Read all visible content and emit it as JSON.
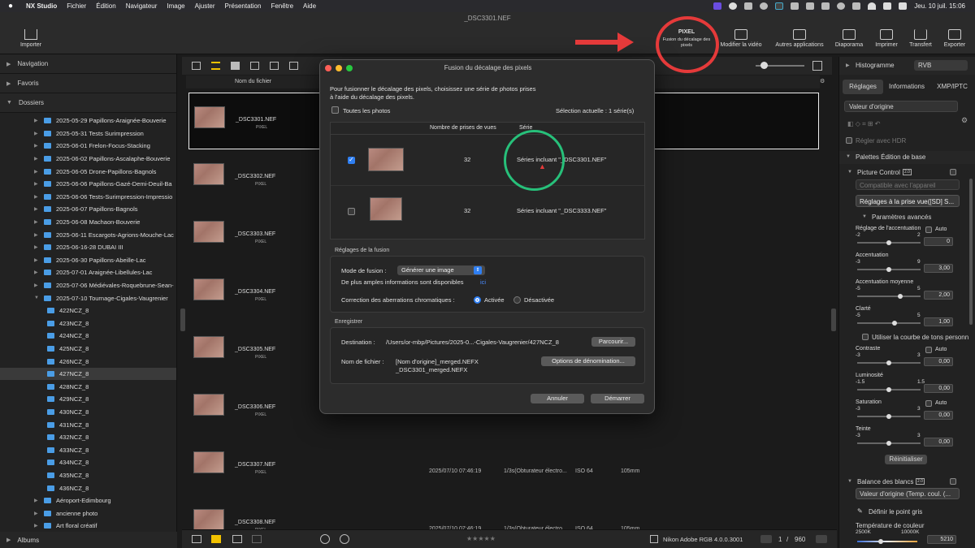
{
  "menubar": {
    "app": "NX Studio",
    "items": [
      "Fichier",
      "Édition",
      "Navigateur",
      "Image",
      "Ajuster",
      "Présentation",
      "Fenêtre",
      "Aide"
    ],
    "clock": "Jeu. 10 juil.  15:06"
  },
  "window": {
    "title": "_DSC3301.NEF"
  },
  "toolbar": {
    "import": "Importer",
    "pixel_shift": "Fusion du décalage des pixels",
    "pixel_badge": "PIXEL",
    "edit_video": "Modifier la vidéo",
    "other_apps": "Autres applications",
    "slideshow": "Diaporama",
    "print": "Imprimer",
    "transfer": "Transfert",
    "export": "Exporter"
  },
  "left": {
    "navigation": "Navigation",
    "favorites": "Favoris",
    "folders": "Dossiers",
    "albums": "Albums",
    "tree": [
      {
        "label": "2025-05-29 Papillons-Araignée-Bouverie",
        "level": 1
      },
      {
        "label": "2025-05-31 Tests Surimpression",
        "level": 1
      },
      {
        "label": "2025-06-01 Frelon-Focus-Stacking",
        "level": 1
      },
      {
        "label": "2025-06-02 Papillons-Ascalaphe-Bouverie",
        "level": 1
      },
      {
        "label": "2025-06-05 Drone-Papillons-Bagnols",
        "level": 1
      },
      {
        "label": "2025-06-06 Papillons-Gazé-Demi-Deuil-Ba",
        "level": 1
      },
      {
        "label": "2025-06-06 Tests-Surimpression-Impressio",
        "level": 1
      },
      {
        "label": "2025-06-07 Papillons-Bagnols",
        "level": 1
      },
      {
        "label": "2025-06-08 Machaon-Bouverie",
        "level": 1
      },
      {
        "label": "2025-06-11 Escargots-Agrions-Mouche-Lac",
        "level": 1
      },
      {
        "label": "2025-06-16-28 DUBAI III",
        "level": 1
      },
      {
        "label": "2025-06-30 Papillons-Abeille-Lac",
        "level": 1
      },
      {
        "label": "2025-07-01 Araignée-Libellules-Lac",
        "level": 1
      },
      {
        "label": "2025-07-06 Médiévales-Roquebrune-Sean-",
        "level": 1
      },
      {
        "label": "2025-07-10 Tournage-Cigales-Vaugrenier",
        "level": 1,
        "open": true
      },
      {
        "label": "422NCZ_8",
        "level": 2
      },
      {
        "label": "423NCZ_8",
        "level": 2
      },
      {
        "label": "424NCZ_8",
        "level": 2
      },
      {
        "label": "425NCZ_8",
        "level": 2
      },
      {
        "label": "426NCZ_8",
        "level": 2
      },
      {
        "label": "427NCZ_8",
        "level": 2,
        "selected": true
      },
      {
        "label": "428NCZ_8",
        "level": 2
      },
      {
        "label": "429NCZ_8",
        "level": 2
      },
      {
        "label": "430NCZ_8",
        "level": 2
      },
      {
        "label": "431NCZ_8",
        "level": 2
      },
      {
        "label": "432NCZ_8",
        "level": 2
      },
      {
        "label": "433NCZ_8",
        "level": 2
      },
      {
        "label": "434NCZ_8",
        "level": 2
      },
      {
        "label": "435NCZ_8",
        "level": 2
      },
      {
        "label": "436NCZ_8",
        "level": 2
      },
      {
        "label": "Aéroport-Edimbourg",
        "level": 1
      },
      {
        "label": "ancienne photo",
        "level": 1
      },
      {
        "label": "Art floral créatif",
        "level": 1
      }
    ]
  },
  "browser": {
    "column_name": "Nom du fichier",
    "pixel_badge": "PIXEL",
    "rows": [
      {
        "name": "_DSC3301.NEF",
        "date": "",
        "shutter": "",
        "iso": "",
        "focal": "",
        "selected": true
      },
      {
        "name": "_DSC3302.NEF",
        "date": "",
        "shutter": "",
        "iso": "",
        "focal": ""
      },
      {
        "name": "_DSC3303.NEF",
        "date": "",
        "shutter": "",
        "iso": "",
        "focal": ""
      },
      {
        "name": "_DSC3304.NEF",
        "date": "",
        "shutter": "",
        "iso": "",
        "focal": ""
      },
      {
        "name": "_DSC3305.NEF",
        "date": "",
        "shutter": "",
        "iso": "",
        "focal": ""
      },
      {
        "name": "_DSC3306.NEF",
        "date": "",
        "shutter": "",
        "iso": "",
        "focal": ""
      },
      {
        "name": "_DSC3307.NEF",
        "date": "2025/07/10 07:46:19",
        "shutter": "1/3s(Obturateur électro...",
        "iso": "ISO 64",
        "focal": "105mm"
      },
      {
        "name": "_DSC3308.NEF",
        "date": "2025/07/10 07:46:19",
        "shutter": "1/3s(Obturateur électro...",
        "iso": "ISO 64",
        "focal": "105mm"
      }
    ]
  },
  "bottombar": {
    "stars": "★★★★★",
    "color_profile": "Nikon Adobe RGB 4.0.0.3001",
    "page": "1",
    "total": "960"
  },
  "right": {
    "histogram": "Histogramme",
    "channel": "RVB",
    "tabs": [
      "Réglages",
      "Informations",
      "XMP/IPTC"
    ],
    "preset": "Valeur d'origine",
    "hdr": "Régler avec HDR",
    "palettes": "Palettes Édition de base",
    "picture_control": "Picture Control",
    "badge": "2.0",
    "compat": "Compatible avec l'appareil",
    "pc_value": "Réglages à la prise vue([SD] S...",
    "advanced": "Paramètres avancés",
    "sliders": [
      {
        "label": "Réglage de l'accentuation",
        "min": "-2",
        "max": "2",
        "value": "0",
        "auto": true
      },
      {
        "label": "Accentuation",
        "min": "-3",
        "max": "9",
        "value": "3,00"
      },
      {
        "label": "Accentuation moyenne",
        "min": "-5",
        "max": "5",
        "value": "2,00"
      },
      {
        "label": "Clarté",
        "min": "-5",
        "max": "5",
        "value": "1,00"
      }
    ],
    "tone_curve": "Utiliser la courbe de tons personn",
    "sliders2": [
      {
        "label": "Contraste",
        "min": "-3",
        "max": "3",
        "value": "0,00",
        "auto": true
      },
      {
        "label": "Luminosité",
        "min": "-1.5",
        "max": "1.5",
        "value": "0,00"
      },
      {
        "label": "Saturation",
        "min": "-3",
        "max": "3",
        "value": "0,00",
        "auto": true
      },
      {
        "label": "Teinte",
        "min": "-3",
        "max": "3",
        "value": "0,00"
      }
    ],
    "auto": "Auto",
    "reset": "Réinitialiser",
    "wb": "Balance des blancs",
    "wb_value": "Valeur d'origine (Temp. coul. (...",
    "grey_point": "Définir le point gris",
    "temp": "Température de couleur",
    "temp_min": "2500K",
    "temp_max": "10000K",
    "temp_value": "5210"
  },
  "dialog": {
    "title": "Fusion du décalage des pixels",
    "intro1": "Pour fusionner le décalage des pixels, choisissez une série de photos prises",
    "intro2": "à l'aide du décalage des pixels.",
    "all_photos": "Toutes les photos",
    "selection": "Sélection actuelle : 1 série(s)",
    "col_count": "Nombre de prises de vues",
    "col_series": "Série",
    "series": [
      {
        "count": "32",
        "label": "Séries incluant \"_DSC3301.NEF\"",
        "checked": true
      },
      {
        "count": "32",
        "label": "Séries incluant \"_DSC3333.NEF\"",
        "checked": false
      }
    ],
    "fusion_settings": "Réglages de la fusion",
    "mode_label": "Mode de fusion :",
    "mode_value": "Générer une image",
    "more_info": "De plus amples informations sont disponibles",
    "here": "ici",
    "aberration": "Correction des aberrations chromatiques :",
    "on": "Activée",
    "off": "Désactivée",
    "save": "Enregistrer",
    "dest_label": "Destination :",
    "dest_value": "/Users/or-mbp/Pictures/2025-0...-Cigales-Vaugrenier/427NCZ_8",
    "browse": "Parcourir...",
    "filename_label": "Nom de fichier :",
    "filename_value": "[Nom d'origine]_merged.NEFX",
    "filename_example": "_DSC3301_merged.NEFX",
    "naming": "Options de dénomination...",
    "cancel": "Annuler",
    "start": "Démarrer"
  }
}
